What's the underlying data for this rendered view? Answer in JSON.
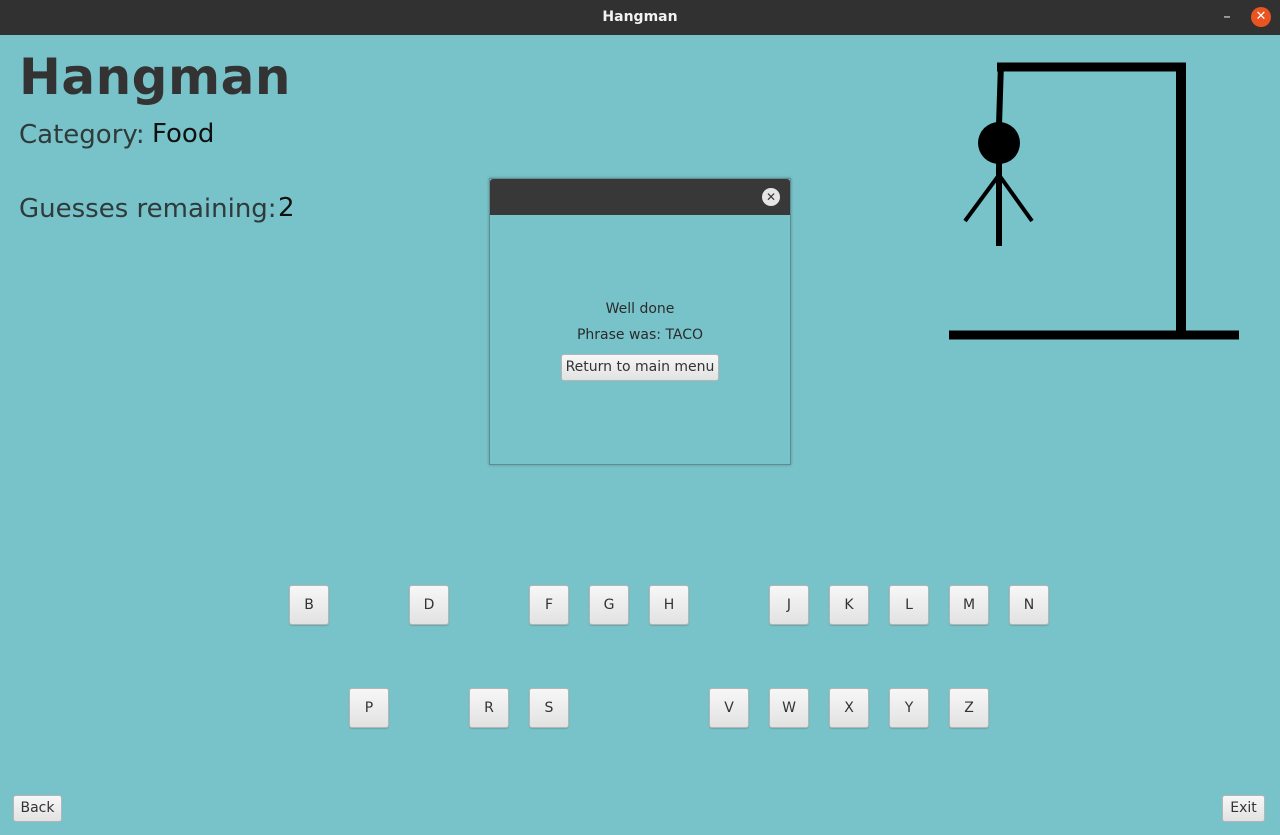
{
  "window": {
    "title": "Hangman",
    "minimize_glyph": "–",
    "close_glyph": "✕"
  },
  "header": {
    "app_title": "Hangman",
    "category_label": "Category:",
    "category_value": "Food",
    "guesses_label": "Guesses remaining:",
    "guesses_value": "2"
  },
  "keyboard": {
    "row1": [
      "B",
      "D",
      "F",
      "G",
      "H",
      "J",
      "K",
      "L",
      "M",
      "N"
    ],
    "row2": [
      "P",
      "R",
      "S",
      "V",
      "W",
      "X",
      "Y",
      "Z"
    ]
  },
  "dialog": {
    "close_glyph": "✕",
    "message": "Well done",
    "phrase_line": "Phrase was: TACO",
    "button_label": "Return to main menu"
  },
  "footer": {
    "back_label": "Back",
    "exit_label": "Exit"
  },
  "colors": {
    "background": "#78c3c9",
    "titlebar": "#323131",
    "close_accent": "#e95420"
  }
}
